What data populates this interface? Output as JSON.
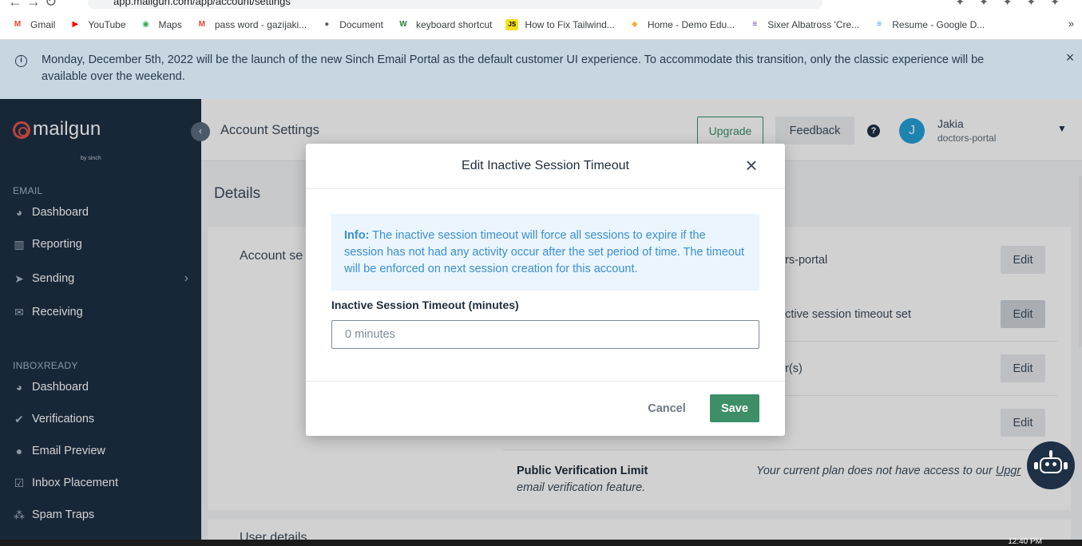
{
  "browser": {
    "url": "app.mailgun.com/app/account/settings",
    "bookmarks": [
      {
        "label": "Gmail",
        "icon": "gmail-icon",
        "glyph": "M",
        "color": "#ea4335"
      },
      {
        "label": "YouTube",
        "icon": "youtube-icon",
        "glyph": "▶",
        "color": "#ff0000"
      },
      {
        "label": "Maps",
        "icon": "maps-icon",
        "glyph": "◉",
        "color": "#34a853"
      },
      {
        "label": "pass word - gazijaki...",
        "icon": "gmail-icon",
        "glyph": "M",
        "color": "#ea4335"
      },
      {
        "label": "Document",
        "icon": "document-icon",
        "glyph": "●",
        "color": "#5f6368"
      },
      {
        "label": "keyboard shortcut",
        "icon": "w-icon",
        "glyph": "W",
        "color": "#1b8a2f"
      },
      {
        "label": "How to Fix Tailwind...",
        "icon": "js-icon",
        "glyph": "JS",
        "color": "#f7df1e"
      },
      {
        "label": "Home - Demo Edu...",
        "icon": "edu-icon",
        "glyph": "◆",
        "color": "#f2b13a"
      },
      {
        "label": "Sixer Albatross 'Cre...",
        "icon": "list-icon",
        "glyph": "≡",
        "color": "#673ab7"
      },
      {
        "label": "Resume - Google D...",
        "icon": "docs-icon",
        "glyph": "≡",
        "color": "#4285f4"
      }
    ],
    "bookmarks_more": "»"
  },
  "banner": {
    "text": "Monday, December 5th, 2022 will be the launch of the new Sinch Email Portal as the default customer UI experience. To accommodate this transition, only the classic experience will be available over the weekend.",
    "close": "×"
  },
  "sidebar": {
    "logo": "mailgun",
    "logo_sub": "by sinch",
    "sections": [
      {
        "title": "EMAIL",
        "items": [
          {
            "label": "Dashboard",
            "icon": "dashboard-icon",
            "glyph": "◕"
          },
          {
            "label": "Reporting",
            "icon": "reporting-icon",
            "glyph": "▥"
          },
          {
            "label": "Sending",
            "icon": "sending-icon",
            "glyph": "➤",
            "chevron": "›"
          },
          {
            "label": "Receiving",
            "icon": "receiving-icon",
            "glyph": "✉"
          }
        ]
      },
      {
        "title": "INBOXREADY",
        "items": [
          {
            "label": "Dashboard",
            "icon": "dashboard-icon",
            "glyph": "◕"
          },
          {
            "label": "Verifications",
            "icon": "verifications-icon",
            "glyph": "✔"
          },
          {
            "label": "Email Preview",
            "icon": "email-preview-icon",
            "glyph": "●"
          },
          {
            "label": "Inbox Placement",
            "icon": "inbox-placement-icon",
            "glyph": "☑"
          },
          {
            "label": "Spam Traps",
            "icon": "spam-traps-icon",
            "glyph": "⁂"
          }
        ]
      }
    ]
  },
  "header": {
    "title": "Account Settings",
    "upgrade": "Upgrade",
    "feedback": "Feedback",
    "help": "?",
    "user": {
      "initial": "J",
      "name": "Jakia",
      "org": "doctors-portal"
    }
  },
  "page": {
    "details_heading": "Details",
    "card_heading": "Account se",
    "rows": [
      {
        "value": "ors-portal",
        "edit": "Edit"
      },
      {
        "value": "active session timeout set",
        "edit": "Edit"
      },
      {
        "value": "ur(s)",
        "edit": "Edit"
      },
      {
        "value": "",
        "edit": "Edit"
      }
    ],
    "public_verification": {
      "title": "Public Verification Limit",
      "desc": "email verification feature.",
      "note": "Your current plan does not have access to our ",
      "link": "Upgr"
    },
    "card2_heading": "User details"
  },
  "modal": {
    "title": "Edit Inactive Session Timeout",
    "close": "×",
    "info_label": "Info:",
    "info_text": " The inactive session timeout will force all sessions to expire if the session has not had any activity occur after the set period of time. The timeout will be enforced on next session creation for this account.",
    "field_label": "Inactive Session Timeout (minutes)",
    "field_placeholder": "0 minutes",
    "field_value": "",
    "cancel": "Cancel",
    "save": "Save"
  },
  "colors": {
    "sidebar_bg": "#1e3045",
    "brand_red": "#e5534b",
    "primary_green": "#3c8f67",
    "info_blue": "#3d8fd1",
    "banner_bg": "#c8d6e2"
  },
  "taskbar": {
    "clock": "12:40 PM"
  }
}
